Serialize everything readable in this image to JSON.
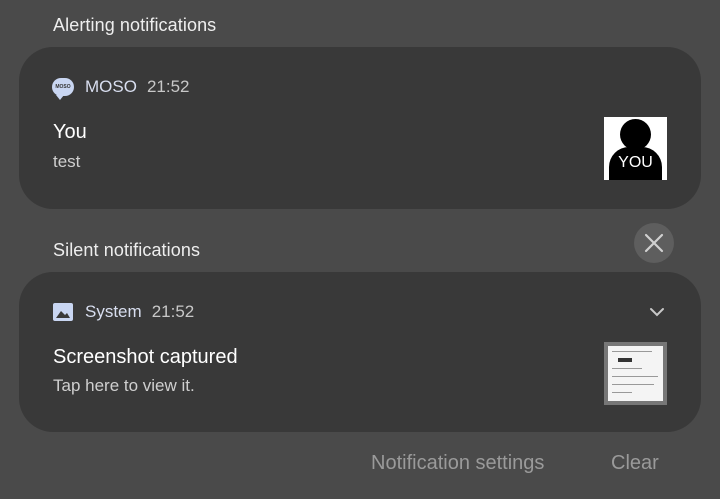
{
  "sections": {
    "alerting_title": "Alerting notifications",
    "silent_title": "Silent notifications"
  },
  "notifications": [
    {
      "app": "MOSO",
      "app_icon": "chat-bubble-icon",
      "icon_text": "MOSO",
      "time": "21:52",
      "title": "You",
      "text": "test",
      "avatar_label": "YOU"
    },
    {
      "app": "System",
      "app_icon": "image-icon",
      "time": "21:52",
      "title": "Screenshot captured",
      "text": "Tap here to view it."
    }
  ],
  "footer": {
    "settings_label": "Notification settings",
    "clear_label": "Clear"
  },
  "colors": {
    "background": "#4a4a4a",
    "card": "#393939",
    "app_name": "#d8deef",
    "footer_text": "#9a9a9a"
  }
}
